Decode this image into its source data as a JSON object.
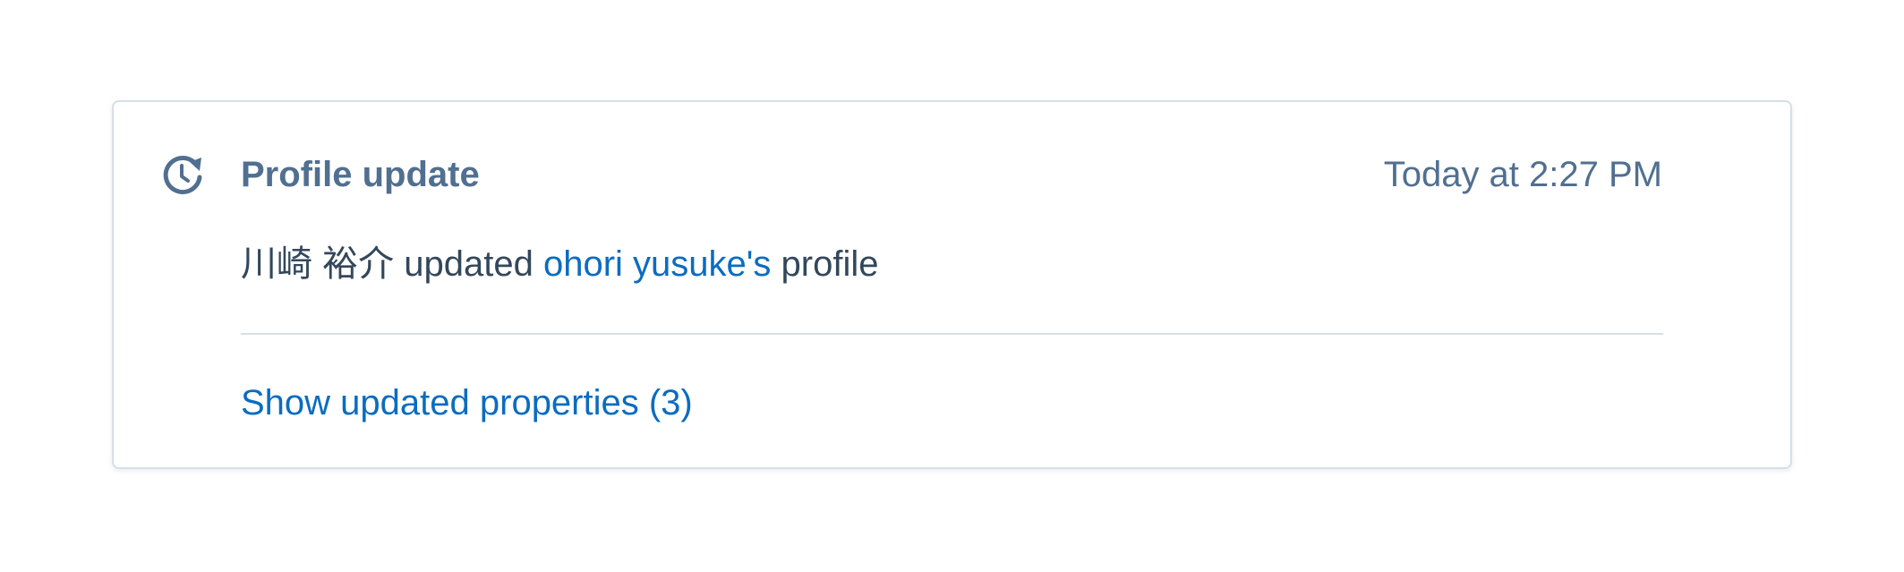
{
  "activity": {
    "icon": "history-clock-icon",
    "title": "Profile update",
    "timestamp": "Today at 2:27 PM",
    "actor": "川崎 裕介",
    "verb": "updated",
    "target_link": "ohori yusuke's",
    "object": "profile",
    "show_properties_label": "Show updated properties (3)"
  },
  "colors": {
    "heading": "#516f90",
    "body_text": "#33475b",
    "link": "#0b6cc1",
    "border": "#d5e0e8"
  }
}
